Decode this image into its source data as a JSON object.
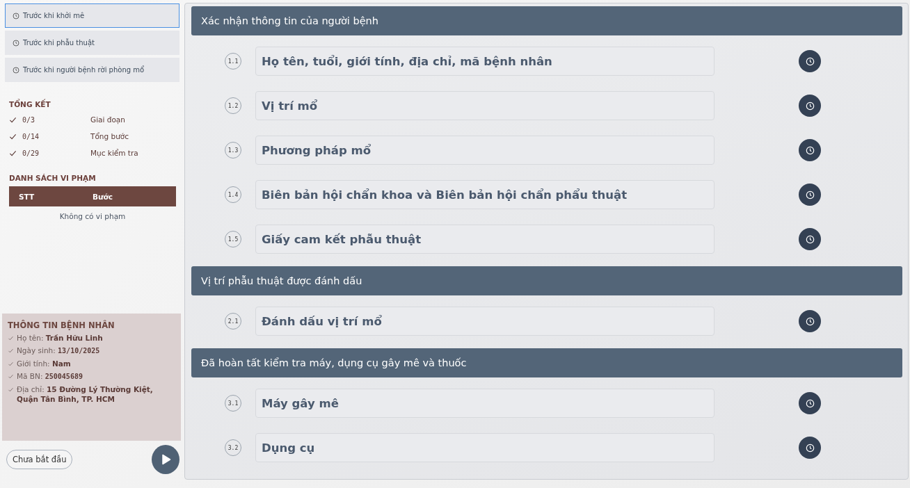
{
  "stages": [
    {
      "label": "Trước khi khởi mê",
      "selected": true
    },
    {
      "label": "Trước khi phẫu thuật",
      "selected": false
    },
    {
      "label": "Trước khi người bệnh rời phòng mổ",
      "selected": false
    }
  ],
  "summary": {
    "title": "TỔNG KẾT",
    "items": [
      {
        "count": "0/3",
        "label": "Giai đoạn"
      },
      {
        "count": "0/14",
        "label": "Tổng bước"
      },
      {
        "count": "0/29",
        "label": "Mục kiểm tra"
      }
    ]
  },
  "violations": {
    "title": "DANH SÁCH VI PHẠM",
    "columns": [
      "STT",
      "Bước"
    ],
    "empty": "Không có vi phạm"
  },
  "patient": {
    "title": "THÔNG TIN BỆNH NHÂN",
    "fields": [
      {
        "label": "Họ tên:",
        "value": "Trần Hữu Linh",
        "kind": "text"
      },
      {
        "label": "Ngày sinh:",
        "value": "13/10/2025",
        "kind": "mono"
      },
      {
        "label": "Giới tính:",
        "value": "Nam",
        "kind": "text"
      },
      {
        "label": "Mã BN:",
        "value": "250045689",
        "kind": "mono"
      },
      {
        "label": "Địa chỉ:",
        "value": "15 Đường Lý Thường Kiệt, Quận Tân Bình, TP. HCM",
        "kind": "text"
      }
    ]
  },
  "status": "Chưa bắt đầu",
  "sections": [
    {
      "title": "Xác nhận thông tin của người bệnh",
      "steps": [
        {
          "number": "1.1",
          "label": "Họ tên, tuổi, giới tính, địa chỉ, mã bệnh nhân"
        },
        {
          "number": "1.2",
          "label": "Vị trí mổ"
        },
        {
          "number": "1.3",
          "label": "Phương pháp mổ"
        },
        {
          "number": "1.4",
          "label": "Biên bản hội chẩn khoa và Biên bản hội chẩn phẩu thuật"
        },
        {
          "number": "1.5",
          "label": "Giấy cam kết phẫu thuật"
        }
      ]
    },
    {
      "title": "Vị trí phẫu thuật được đánh dấu",
      "steps": [
        {
          "number": "2.1",
          "label": "Đánh dấu vị trí mổ"
        }
      ]
    },
    {
      "title": "Đã hoàn tất kiểm tra máy, dụng cụ gây mê và thuốc",
      "steps": [
        {
          "number": "3.1",
          "label": "Máy gây mê"
        },
        {
          "number": "3.2",
          "label": "Dụng cụ"
        }
      ]
    }
  ]
}
